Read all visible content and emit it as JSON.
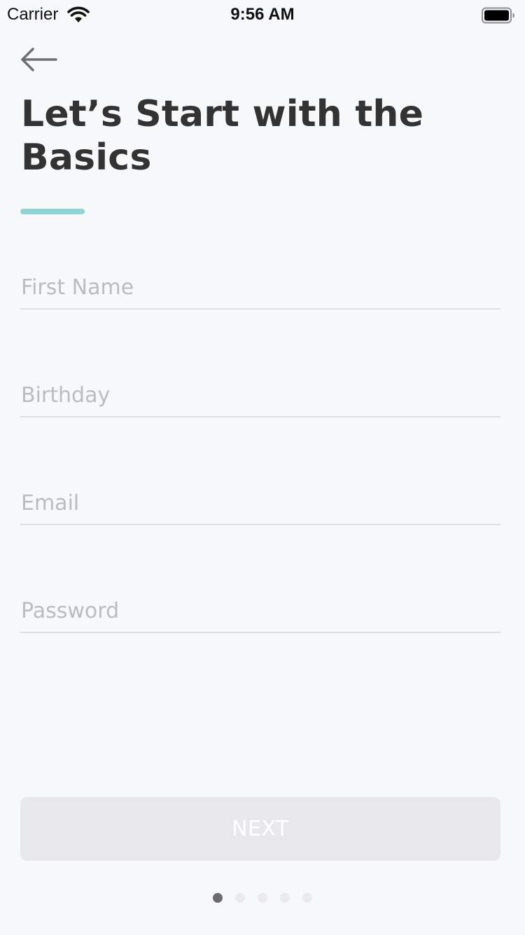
{
  "status_bar": {
    "carrier": "Carrier",
    "time": "9:56 AM",
    "icons": [
      "wifi-icon",
      "battery-icon"
    ]
  },
  "header": {
    "back_icon": "arrow-left-icon",
    "title": "Let’s Start with the Basics"
  },
  "colors": {
    "accent": "#8fd3d2",
    "background": "#f7f8fa",
    "title_text": "#333333",
    "placeholder": "#b9bcc3",
    "button_disabled_bg": "#e8e8ec",
    "active_dot": "#6b6b70",
    "inactive_dot": "#eaeaee"
  },
  "form": {
    "first_name": {
      "placeholder": "First Name",
      "value": ""
    },
    "birthday": {
      "placeholder": "Birthday",
      "value": ""
    },
    "email": {
      "placeholder": "Email",
      "value": ""
    },
    "password": {
      "placeholder": "Password",
      "value": ""
    }
  },
  "next_button": {
    "label": "NEXT",
    "enabled": false
  },
  "pagination": {
    "total": 5,
    "current": 1
  }
}
